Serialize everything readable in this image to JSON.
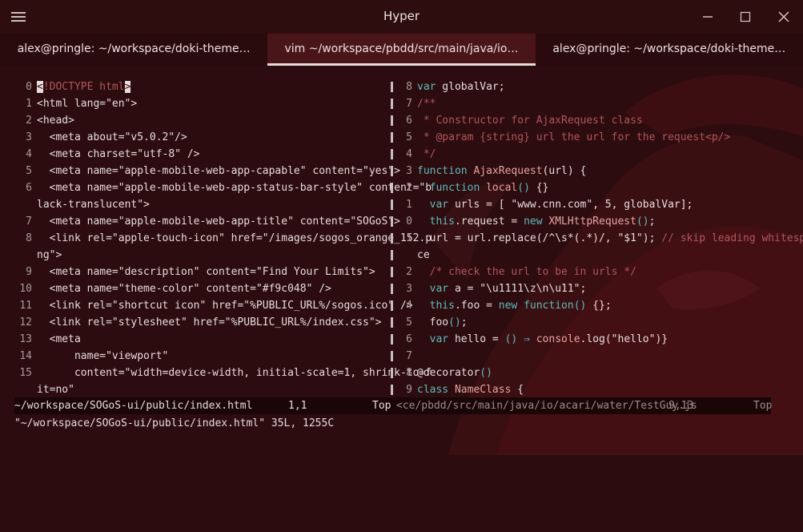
{
  "window": {
    "title": "Hyper",
    "icons": [
      "menu-icon",
      "minimize-icon",
      "maximize-icon",
      "close-icon"
    ]
  },
  "tabs": [
    {
      "label": "alex@pringle: ~/workspace/doki-theme…",
      "active": false
    },
    {
      "label": "vim ~/workspace/pbdd/src/main/java/io…",
      "active": true
    },
    {
      "label": "alex@pringle: ~/workspace/doki-theme…",
      "active": false
    }
  ],
  "left_pane": {
    "lines": [
      {
        "n": "0",
        "text": "<!DOCTYPE html>"
      },
      {
        "n": "1",
        "text": "<html lang=\"en\">"
      },
      {
        "n": "2",
        "text": "<head>"
      },
      {
        "n": "3",
        "text": "  <meta about=\"v5.0.2\"/>"
      },
      {
        "n": "4",
        "text": "  <meta charset=\"utf-8\" />"
      },
      {
        "n": "5",
        "text": "  <meta name=\"apple-mobile-web-app-capable\" content=\"yes\">"
      },
      {
        "n": "6",
        "text": "  <meta name=\"apple-mobile-web-app-status-bar-style\" content=\"b"
      },
      {
        "n": "",
        "text": "lack-translucent\">"
      },
      {
        "n": "7",
        "text": "  <meta name=\"apple-mobile-web-app-title\" content=\"SOGoS\">"
      },
      {
        "n": "8",
        "text": "  <link rel=\"apple-touch-icon\" href=\"/images/sogos_orange_152.p"
      },
      {
        "n": "",
        "text": "ng\">"
      },
      {
        "n": "9",
        "text": "  <meta name=\"description\" content=\"Find Your Limits\">"
      },
      {
        "n": "10",
        "text": "  <meta name=\"theme-color\" content=\"#f9c048\" />"
      },
      {
        "n": "11",
        "text": "  <link rel=\"shortcut icon\" href=\"%PUBLIC_URL%/sogos.ico\" />"
      },
      {
        "n": "12",
        "text": "  <link rel=\"stylesheet\" href=\"%PUBLIC_URL%/index.css\">"
      },
      {
        "n": "13",
        "text": "  <meta"
      },
      {
        "n": "14",
        "text": "      name=\"viewport\""
      },
      {
        "n": "15",
        "text": "      content=\"width=device-width, initial-scale=1, shrink-to-f"
      },
      {
        "n": "",
        "text": "it=no\""
      }
    ]
  },
  "right_pane": {
    "lines": [
      {
        "n": "8",
        "text": "var globalVar;"
      },
      {
        "n": "7",
        "text": "/**"
      },
      {
        "n": "6",
        "text": " * Constructor for AjaxRequest class"
      },
      {
        "n": "5",
        "text": " * @param {string} url the url for the request<p/>"
      },
      {
        "n": "4",
        "text": " */"
      },
      {
        "n": "3",
        "text": "function AjaxRequest(url) {"
      },
      {
        "n": "2",
        "text": "  function local() {}"
      },
      {
        "n": "1",
        "text": "  var urls = [ \"www.cnn.com\", 5, globalVar];"
      },
      {
        "n": "0",
        "text": "  this.request = new XMLHttpRequest();"
      },
      {
        "n": "1",
        "text": "  url = url.replace(/^\\s*(.*)/, \"$1\"); // skip leading whitespa"
      },
      {
        "n": "",
        "text": "ce"
      },
      {
        "n": "2",
        "text": "  /* check the url to be in urls */"
      },
      {
        "n": "3",
        "text": "  var a = \"\\u1111\\z\\n\\u11\";"
      },
      {
        "n": "4",
        "text": "  this.foo = new function() {};"
      },
      {
        "n": "5",
        "text": "  foo();"
      },
      {
        "n": "6",
        "text": "  var hello = () ⇒ console.log(\"hello\")}"
      },
      {
        "n": "7",
        "text": ""
      },
      {
        "n": "8",
        "text": "@decorator()"
      },
      {
        "n": "9",
        "text": "class NameClass {"
      }
    ]
  },
  "statusline": {
    "left_file": "~/workspace/SOGoS-ui/public/index.html",
    "left_pos": "1,1",
    "left_scroll": "Top",
    "right_file": "<ce/pbdd/src/main/java/io/acari/water/TestGuy.js",
    "right_pos": "9,13",
    "right_scroll": "Top"
  },
  "cmdline": "\"~/workspace/SOGoS-ui/public/index.html\" 35L, 1255C",
  "colors": {
    "background": "#2c0c0e",
    "active_tab": "#4a1519",
    "keyword": "#62b9bd",
    "comment": "#b2565c",
    "function_name": "#e7a4a0"
  }
}
